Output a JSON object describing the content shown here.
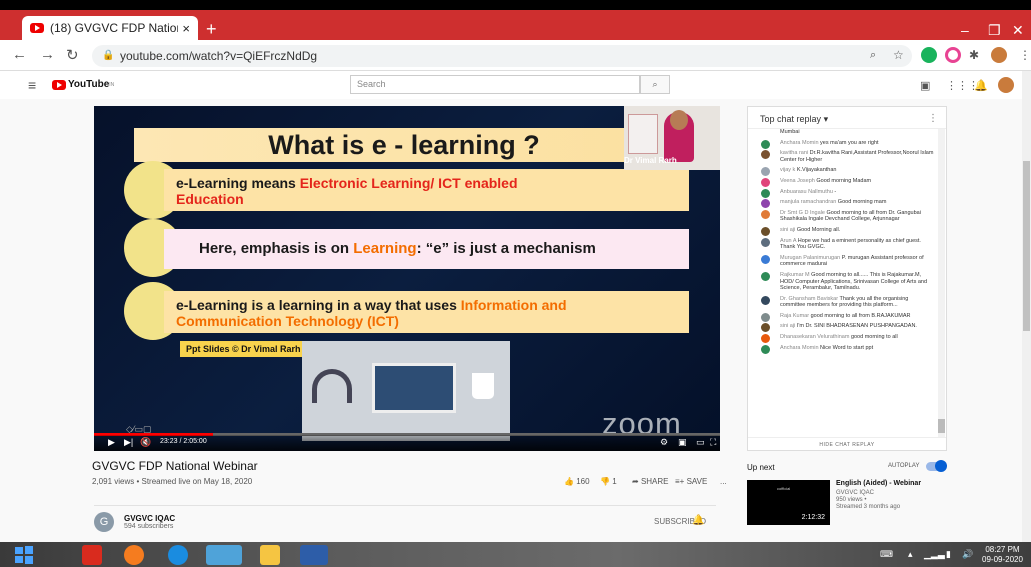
{
  "browser": {
    "tab_title": "(18) GVGVC FDP National Webin",
    "tab_close": "×",
    "new_tab": "+",
    "url": "youtube.com/watch?v=QiEFrczNdDg",
    "win_min": "–",
    "win_max": "❐",
    "win_close": "✕"
  },
  "youtube": {
    "logo_text": "YouTube",
    "logo_region": "IN",
    "search_placeholder": "Search"
  },
  "slide": {
    "title": "What is e - learning ?",
    "bullet1_a": "e-Learning means ",
    "bullet1_b": "Electronic Learning/ ICT enabled",
    "bullet1_c": "Education",
    "bullet2_a": "Here, emphasis is on ",
    "bullet2_b": "Learning",
    "bullet2_c": ": “e” is just a mechanism",
    "bullet3_a": "e-Learning is a learning in a  way that uses ",
    "bullet3_b": "Information and",
    "bullet3_c": "Communication Technology (ICT)",
    "credit": "Ppt Slides © Dr Vimal Rarh",
    "zoom": "zoom",
    "speaker": "Dr Vimal Rarh"
  },
  "player": {
    "time": "23:23 / 2:05:00",
    "progress_fraction": 0.19
  },
  "video": {
    "title": "GVGVC FDP National Webinar",
    "meta": "2,091 views • Streamed live on May 18, 2020",
    "likes": "160",
    "dislikes": "1",
    "share": "SHARE",
    "save": "SAVE",
    "more": "..."
  },
  "channel": {
    "avatar_letter": "G",
    "name": "GVGVC IQAC",
    "subs": "594 subscribers",
    "subscribed": "SUBSCRIBED"
  },
  "chat": {
    "header": "Top chat replay",
    "hide": "HIDE CHAT REPLAY",
    "messages": [
      {
        "author": "",
        "text": "Mumbai",
        "color": "#ffffff"
      },
      {
        "author": "Anchara Momin",
        "text": "yes ma'am you are right",
        "color": "#2e8b57"
      },
      {
        "author": "kavitha rani",
        "text": "Dr.R.kavitha Rani,Assistant Professor,Noorul Islam Center for Higher",
        "color": "#7a5230"
      },
      {
        "author": "vijay k",
        "text": "K.Vijayakanthan",
        "color": "#9aa4b0"
      },
      {
        "author": "Veena Joseph",
        "text": "Good morning Madam",
        "color": "#e0457b"
      },
      {
        "author": "Anbuarasu Nallmuthu",
        "text": "-",
        "color": "#2e8b57"
      },
      {
        "author": "manjula ramachandran",
        "text": "Good morning mam",
        "color": "#8e44ad"
      },
      {
        "author": "Dr Smt G D Ingale",
        "text": "Good morning to all from Dr. Gangubai Shashikala Ingale Devchand College, Arjunnagar",
        "color": "#e07b39"
      },
      {
        "author": "sini aji",
        "text": "Good Morning all.",
        "color": "#6b4f2a"
      },
      {
        "author": "Arun A",
        "text": "Hope we had a eminent personality as chief guest. Thank You GVGC.",
        "color": "#5d6d7e"
      },
      {
        "author": "Murugan Palanimurugan",
        "text": "P. murugan Assistant professor of commerce madurai",
        "color": "#3a7bd5"
      },
      {
        "author": "Rajkumar M",
        "text": "Good morning to all...... This is Rajakumar.M, HOD/ Computer Applications, Srinivasan College of Arts and Science, Perambalur, Tamilnadu.",
        "color": "#2e8b57"
      },
      {
        "author": "Dr. Ghansham Baviskar",
        "text": "Thank you all the organising committee members for providing this platform...",
        "color": "#34495e"
      },
      {
        "author": "Raja Kumar",
        "text": "good morning to all from B.RAJAKUMAR",
        "color": "#7f8c8d"
      },
      {
        "author": "sini aji",
        "text": "I'm Dr. SINI BHADRASENAN PUSHPANGADAN.",
        "color": "#6b4f2a"
      },
      {
        "author": "Dhanasekaran Velurathinam",
        "text": "good morning to all",
        "color": "#e8590c"
      },
      {
        "author": "Anchara Momin",
        "text": "Nice Word to start ppt",
        "color": "#2e8b57"
      }
    ]
  },
  "upnext": {
    "label": "Up next",
    "autoplay": "AUTOPLAY",
    "title": "English (Aided) - Webinar",
    "channel": "GVGVC IQAC",
    "views": "950 views •",
    "when": "Streamed 3 months ago",
    "duration": "2:12:32",
    "thumb_text": "cofficial"
  },
  "taskbar": {
    "time": "08:27 PM",
    "date": "09-09-2020"
  },
  "colors": {
    "tabbar": "#ce2f2f",
    "youtube_red": "#ff0000",
    "like_blue": "#065fd4"
  }
}
